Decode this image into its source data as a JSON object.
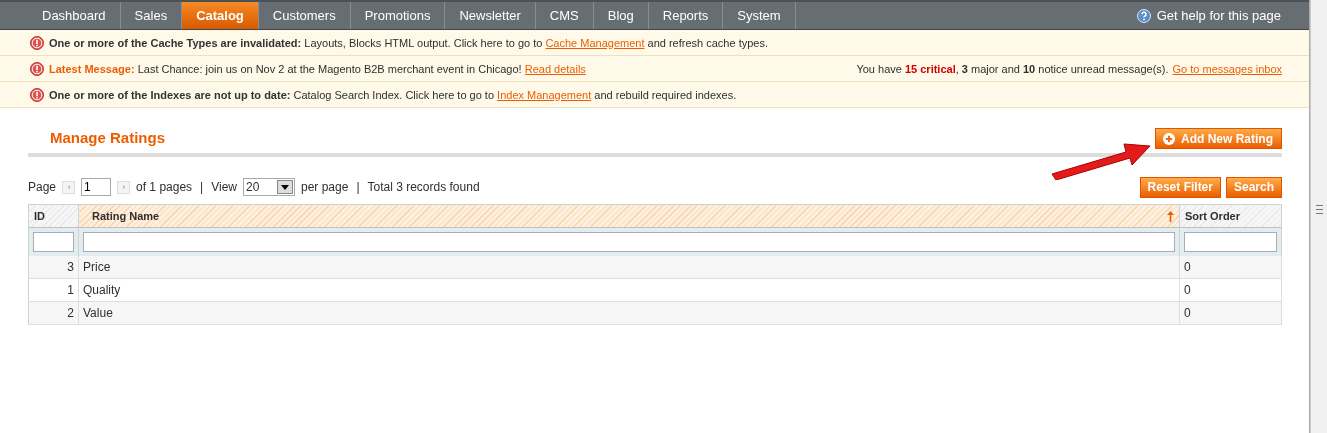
{
  "nav": {
    "items": [
      {
        "label": "Dashboard",
        "selected": false
      },
      {
        "label": "Sales",
        "selected": false
      },
      {
        "label": "Catalog",
        "selected": true
      },
      {
        "label": "Customers",
        "selected": false
      },
      {
        "label": "Promotions",
        "selected": false
      },
      {
        "label": "Newsletter",
        "selected": false
      },
      {
        "label": "CMS",
        "selected": false
      },
      {
        "label": "Blog",
        "selected": false
      },
      {
        "label": "Reports",
        "selected": false
      },
      {
        "label": "System",
        "selected": false
      }
    ],
    "help": "Get help for this page"
  },
  "messages": [
    {
      "kind": "notice",
      "title": "One or more of the Cache Types are invalidated:",
      "text": "Layouts, Blocks HTML output. Click here to go to",
      "link": "Cache Management",
      "after": "and refresh cache types."
    },
    {
      "kind": "latest",
      "title": "Latest Message:",
      "text": "Last Chance: join us on Nov 2 at the Magento B2B merchant event in Chicago!",
      "link": "Read details",
      "summary": [
        {
          "text": "You have ",
          "kind": "plain"
        },
        {
          "text": "15 critical",
          "kind": "critical"
        },
        {
          "text": ", ",
          "kind": "plain"
        },
        {
          "text": "3",
          "kind": "bold"
        },
        {
          "text": " major and ",
          "kind": "plain"
        },
        {
          "text": "10",
          "kind": "bold"
        },
        {
          "text": " notice unread message(s).",
          "kind": "plain"
        }
      ],
      "summary_link": "Go to messages inbox"
    },
    {
      "kind": "notice",
      "title": "One or more of the Indexes are not up to date:",
      "text": "Catalog Search Index. Click here to go to",
      "link": "Index Management",
      "after": "and rebuild required indexes."
    }
  ],
  "page_title": "Manage Ratings",
  "add_button": "Add New Rating",
  "pager": {
    "separators": [
      "|",
      "|"
    ],
    "page_label": "Page",
    "page": "1",
    "of_pages": "of 1 pages",
    "view_label": "View",
    "per_page": "20",
    "per_page_label": "per page",
    "total": "Total 3 records found"
  },
  "grid_buttons": [
    "Reset Filter",
    "Search"
  ],
  "table": {
    "columns": [
      {
        "label": "ID",
        "sorted": false
      },
      {
        "label": "Rating Name",
        "sorted": true
      },
      {
        "label": "Sort Order",
        "sorted": false
      }
    ],
    "rows": [
      [
        "3",
        "Price",
        "0"
      ],
      [
        "1",
        "Quality",
        "0"
      ],
      [
        "2",
        "Value",
        "0"
      ]
    ]
  }
}
